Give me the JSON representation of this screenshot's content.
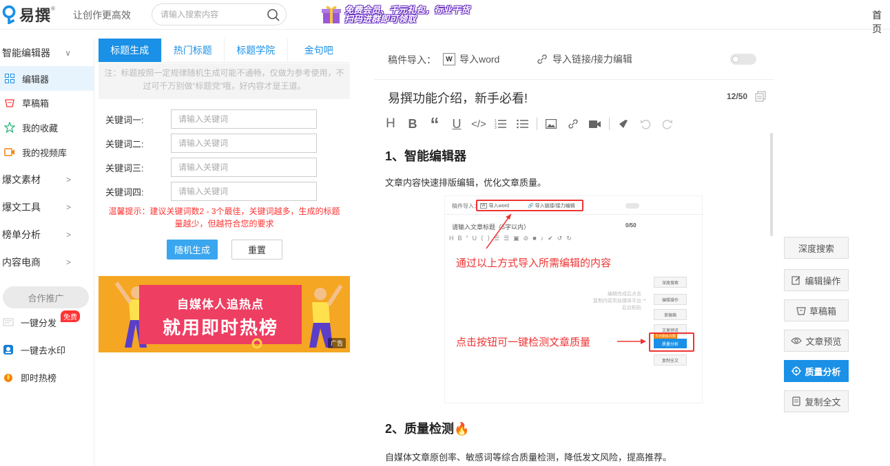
{
  "header": {
    "logo_text": "易撰",
    "logo_mark": "®",
    "slogan": "让创作更高效",
    "search_placeholder": "请输入搜索内容",
    "promo_line1": "免费会员、千元礼包，行业干货",
    "promo_line2": "扫码进群即可领取",
    "home": "首页"
  },
  "sidebar": {
    "groups": [
      {
        "label": "智能编辑器",
        "chevron": "∨"
      },
      {
        "label": "爆文素材",
        "chevron": ">"
      },
      {
        "label": "爆文工具",
        "chevron": ">"
      },
      {
        "label": "榜单分析",
        "chevron": ">"
      },
      {
        "label": "内容电商",
        "chevron": ">"
      }
    ],
    "items": [
      {
        "label": "编辑器",
        "icon": "grid-icon",
        "color": "#1a90e6"
      },
      {
        "label": "草稿箱",
        "icon": "basket-icon",
        "color": "#f33"
      },
      {
        "label": "我的收藏",
        "icon": "star-icon",
        "color": "#2ab77a"
      },
      {
        "label": "我的视频库",
        "icon": "video-icon",
        "color": "#f5820a"
      }
    ],
    "coop": "合作推广",
    "tools": [
      {
        "label": "一键分发",
        "icon": "distribute-icon"
      },
      {
        "label": "一键去水印",
        "icon": "watermark-icon"
      },
      {
        "label": "即时热榜",
        "icon": "hot-icon"
      }
    ],
    "free_badge": "免费"
  },
  "panel": {
    "tabs": [
      "标题生成",
      "热门标题",
      "标题学院",
      "金句吧"
    ],
    "active_tab": "标题生成",
    "note": "注：标题按照一定规律随机生成可能不通畅，仅做为参考使用，不过可千万别做“标题党”哦，好内容才是王道。",
    "keywords": [
      {
        "label": "关键词一:",
        "placeholder": "请输入关键词"
      },
      {
        "label": "关键词二:",
        "placeholder": "请输入关键词"
      },
      {
        "label": "关键词三:",
        "placeholder": "请输入关键词"
      },
      {
        "label": "关键词四:",
        "placeholder": "请输入关键词"
      }
    ],
    "tip": "温馨提示：建议关键词数2 - 3个最佳，关键词越多，生成的标题量越少，但越符合您的要求",
    "generate_btn": "随机生成",
    "reset_btn": "重置",
    "ad": {
      "line1": "自媒体人追热点",
      "line2": "就用即时热榜",
      "tag": "广告"
    }
  },
  "editor": {
    "import_label": "稿件导入：",
    "import_word": "导入word",
    "import_link": "导入链接/接力编辑",
    "doc_title": "易撰功能介绍，新手必看!",
    "char_count": "12/50",
    "toolbar": [
      "H",
      "B",
      "“",
      "U",
      "</>",
      "ordered-list",
      "bullet-list",
      "image",
      "link",
      "video",
      "brush",
      "undo",
      "redo"
    ],
    "content": {
      "heading1": "1、智能编辑器",
      "para1": "文章内容快速排版编辑，优化文章质量。",
      "heading2": "2、质量检测🔥",
      "para2": "自媒体文章原创率、敏感词等综合质量检测，降低发文风险，提高推荐。",
      "screenshot": {
        "import_label": "稿件导入：",
        "import_word": "导入word",
        "import_link": "导入链接/接力编辑",
        "title_placeholder": "请输入文章标题（5字以内）",
        "count": "0/50",
        "annotation1": "通过以上方式导入所需编辑的内容",
        "annotation2": "点击按钮可一键检测文章质量",
        "hint_lines": [
          "编辑完成后点击",
          "复制内容到自媒体平台",
          "后台粘贴"
        ],
        "side_buttons": [
          "深度搜索",
          "编辑操作",
          "草稿箱",
          "文章预览",
          "质量分析",
          "复制全文"
        ],
        "today_badge": "今日剩余次数"
      }
    }
  },
  "right_tools": [
    {
      "label": "深度搜索",
      "icon": ""
    },
    {
      "label": "编辑操作",
      "icon": "edit-icon"
    },
    {
      "label": "草稿箱",
      "icon": "basket-icon"
    },
    {
      "label": "文章预览",
      "icon": "eye-icon"
    },
    {
      "label": "质量分析",
      "icon": "target-icon",
      "primary": true
    },
    {
      "label": "复制全文",
      "icon": "copy-icon"
    }
  ]
}
